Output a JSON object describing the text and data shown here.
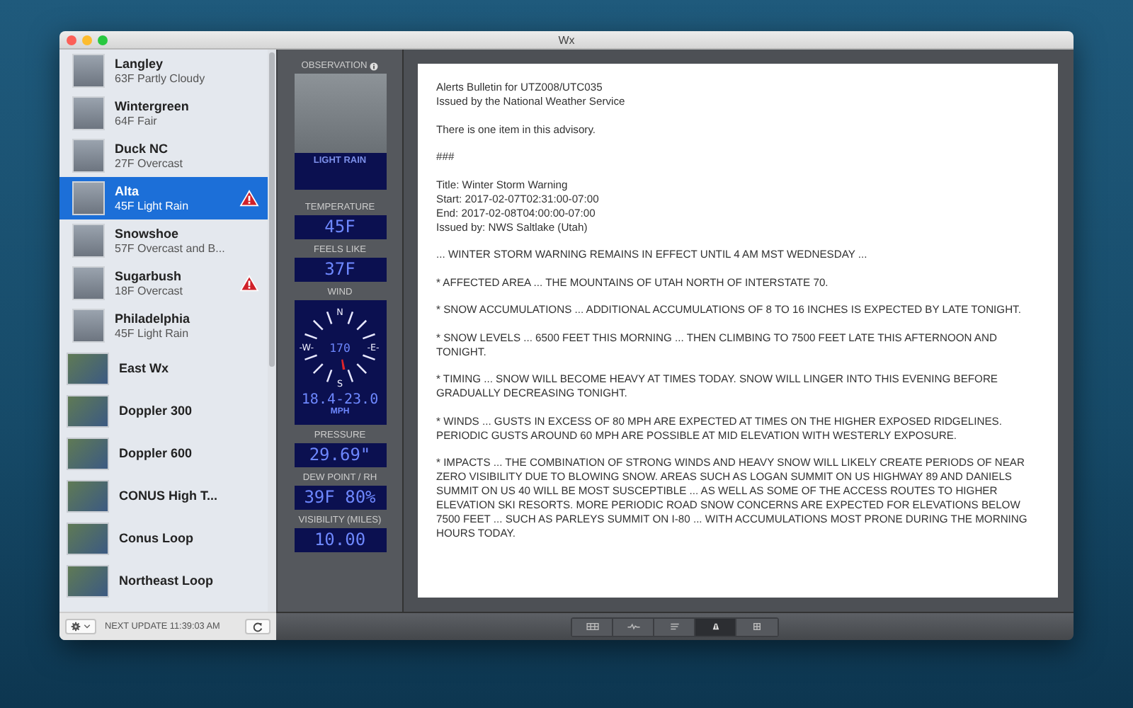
{
  "window": {
    "title": "Wx"
  },
  "locations": [
    {
      "kind": "station",
      "name": "Langley",
      "summary": "63F Partly Cloudy",
      "alert": false,
      "selected": false
    },
    {
      "kind": "station",
      "name": "Wintergreen",
      "summary": "64F Fair",
      "alert": false,
      "selected": false
    },
    {
      "kind": "station",
      "name": "Duck NC",
      "summary": "27F Overcast",
      "alert": false,
      "selected": false
    },
    {
      "kind": "station",
      "name": "Alta",
      "summary": "45F Light Rain",
      "alert": true,
      "selected": true
    },
    {
      "kind": "station",
      "name": "Snowshoe",
      "summary": "57F Overcast and B...",
      "alert": false,
      "selected": false
    },
    {
      "kind": "station",
      "name": "Sugarbush",
      "summary": "18F Overcast",
      "alert": true,
      "selected": false
    },
    {
      "kind": "station",
      "name": "Philadelphia",
      "summary": "45F Light Rain",
      "alert": false,
      "selected": false
    },
    {
      "kind": "map",
      "name": "East Wx",
      "selected": false
    },
    {
      "kind": "map",
      "name": "Doppler 300",
      "selected": false
    },
    {
      "kind": "map",
      "name": "Doppler 600",
      "selected": false
    },
    {
      "kind": "map",
      "name": "CONUS High T...",
      "selected": false
    },
    {
      "kind": "map",
      "name": "Conus Loop",
      "selected": false
    },
    {
      "kind": "map",
      "name": "Northeast Loop",
      "selected": false
    }
  ],
  "sidebar_footer": {
    "next_update": "NEXT UPDATE 11:39:03 AM"
  },
  "observation": {
    "title": "OBSERVATION",
    "condition": "LIGHT RAIN"
  },
  "readings": [
    {
      "kind": "value",
      "label": "TEMPERATURE",
      "value": "45F"
    },
    {
      "kind": "value",
      "label": "FEELS LIKE",
      "value": "37F"
    },
    {
      "kind": "wind",
      "label": "WIND",
      "direction": "170",
      "compass": [
        "N",
        "-W-",
        "-E-",
        "S"
      ],
      "speed": "18.4-23.0",
      "unit": "MPH"
    },
    {
      "kind": "value",
      "label": "PRESSURE",
      "value": "29.69\""
    },
    {
      "kind": "value",
      "label": "DEW POINT / RH",
      "value": "39F 80%"
    },
    {
      "kind": "value",
      "label": "VISIBILITY (MILES)",
      "value": "10.00"
    }
  ],
  "bulletin": {
    "paragraphs": [
      [
        "Alerts Bulletin for UTZ008/UTC035",
        "Issued by the National Weather Service"
      ],
      [
        "There is one item in this advisory."
      ],
      [
        "###"
      ],
      [
        "Title: Winter Storm Warning",
        "Start: 2017-02-07T02:31:00-07:00",
        "End: 2017-02-08T04:00:00-07:00",
        "Issued by: NWS Saltlake (Utah)"
      ],
      [
        "... WINTER STORM WARNING REMAINS IN EFFECT UNTIL 4 AM MST WEDNESDAY ..."
      ],
      [
        "* AFFECTED AREA ... THE MOUNTAINS OF UTAH NORTH OF INTERSTATE 70."
      ],
      [
        "* SNOW ACCUMULATIONS ... ADDITIONAL ACCUMULATIONS OF 8 TO 16 INCHES IS EXPECTED BY LATE TONIGHT."
      ],
      [
        "* SNOW LEVELS ... 6500 FEET THIS MORNING ... THEN CLIMBING TO 7500 FEET LATE THIS AFTERNOON AND TONIGHT."
      ],
      [
        "* TIMING ... SNOW WILL BECOME HEAVY AT TIMES TODAY. SNOW WILL LINGER INTO THIS EVENING BEFORE GRADUALLY DECREASING TONIGHT."
      ],
      [
        "* WINDS ... GUSTS IN EXCESS OF 80 MPH ARE EXPECTED AT TIMES ON THE HIGHER EXPOSED RIDGELINES. PERIODIC GUSTS AROUND 60 MPH ARE POSSIBLE AT MID ELEVATION WITH WESTERLY EXPOSURE."
      ],
      [
        "* IMPACTS ... THE COMBINATION OF STRONG WINDS AND HEAVY SNOW WILL LIKELY CREATE PERIODS OF NEAR ZERO VISIBILITY DUE TO BLOWING SNOW. AREAS SUCH AS LOGAN SUMMIT ON US HIGHWAY 89 AND DANIELS SUMMIT ON US 40 WILL BE MOST SUSCEPTIBLE ... AS WELL AS SOME OF THE ACCESS ROUTES TO HIGHER ELEVATION SKI RESORTS. MORE PERIODIC ROAD SNOW CONCERNS ARE EXPECTED FOR ELEVATIONS BELOW 7500 FEET ... SUCH AS PARLEYS SUMMIT ON I-80 ... WITH ACCUMULATIONS MOST PRONE DURING THE MORNING HOURS TODAY."
      ]
    ]
  },
  "view_modes": [
    {
      "kind": "table",
      "selected": false
    },
    {
      "kind": "wave",
      "selected": false
    },
    {
      "kind": "list",
      "selected": false
    },
    {
      "kind": "road",
      "selected": true
    },
    {
      "kind": "grid",
      "selected": false
    }
  ]
}
